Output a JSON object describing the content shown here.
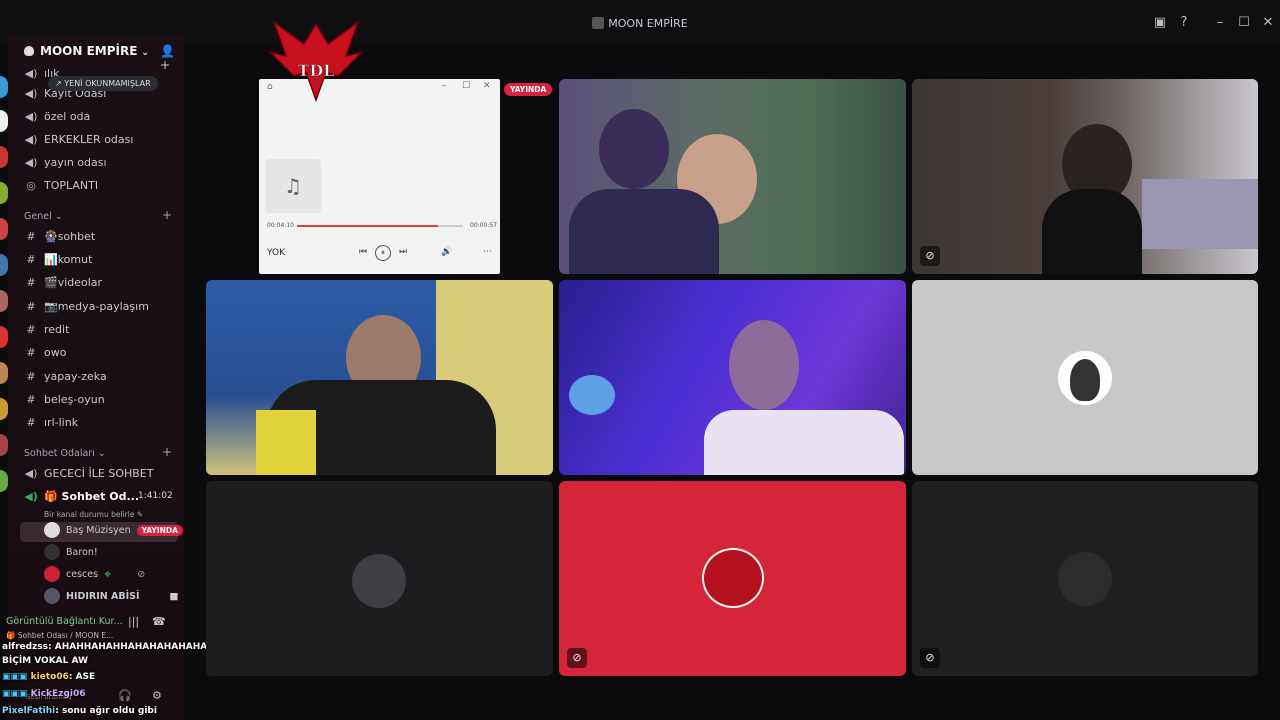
{
  "window": {
    "title": "MOON EMPİRE",
    "controls": {
      "minimize": "–",
      "maximize": "☐",
      "close": "✕"
    }
  },
  "sidebar": {
    "server_name": "MOON EMPİRE",
    "unread_pill": "YENİ OKUNMAMIŞLAR",
    "top_channels": [
      {
        "label": "ılık",
        "icon": "voice-icon"
      },
      {
        "label": "Kayıt Odası",
        "icon": "voice-icon"
      },
      {
        "label": "özel oda",
        "icon": "voice-icon"
      },
      {
        "label": "ERKEKLER odası",
        "icon": "voice-icon"
      },
      {
        "label": "yayın odası",
        "icon": "voice-icon"
      },
      {
        "label": "TOPLANTI",
        "icon": "stage-icon"
      }
    ],
    "cat_general": "Genel",
    "text_channels": [
      {
        "label": "🎡sohbet"
      },
      {
        "label": "📊komut"
      },
      {
        "label": "🎬videolar"
      },
      {
        "label": "📷medya-paylaşım"
      },
      {
        "label": "redit"
      },
      {
        "label": "owo"
      },
      {
        "label": "yapay-zeka"
      },
      {
        "label": "beleş-oyun"
      },
      {
        "label": "ırl-link"
      }
    ],
    "cat_voice": "Sohbet Odaları",
    "voice_channels": [
      {
        "label": "GECECİ İLE SOHBET"
      },
      {
        "label": "🎁 Sohbet Od...",
        "timer": "1:41:02"
      }
    ],
    "channel_status": "Bir kanal durumu belirle",
    "members": [
      {
        "name": "Baş Müzisyen",
        "badge": "YAYINDA"
      },
      {
        "name": "Baron!"
      },
      {
        "name": "cesces"
      },
      {
        "name": "HIDIRIN ABİSİ"
      }
    ],
    "voice_status": "Görüntülü Bağlantı Kur...",
    "voice_channel_path": "🎁 Sohbet Odası / MOON E...",
    "user_status": "Sesli aramad"
  },
  "chat": [
    {
      "user": "alfredzss",
      "text": ": AHAHHAHAHHAHAHAHAHAHAHAHAHHAHAHAHAHHAHA O NE"
    },
    {
      "user": "",
      "text": "BİÇİM VOKAL AW"
    },
    {
      "user": "kieto06",
      "text": ": ASE"
    },
    {
      "user": "KickEzgi06",
      "text": ""
    },
    {
      "user": "PixelFatihi",
      "text": ": sonu ağır oldu gibi"
    }
  ],
  "player": {
    "time_elapsed": "00:04:10",
    "time_total": "00:00:57",
    "progress": 0.85,
    "title": "YOK",
    "icons": {
      "music": "♫",
      "prev": "⏮",
      "pause": "⏸",
      "next": "⏭",
      "volume": "🔊",
      "more": "⋯"
    }
  },
  "stage": {
    "live_label": "YAYINDA",
    "colors": {
      "accent_red": "#d62440",
      "tile_red": "#d42638",
      "tile_gray": "#c8c8c8",
      "tile_dark": "#1d1d20"
    }
  }
}
